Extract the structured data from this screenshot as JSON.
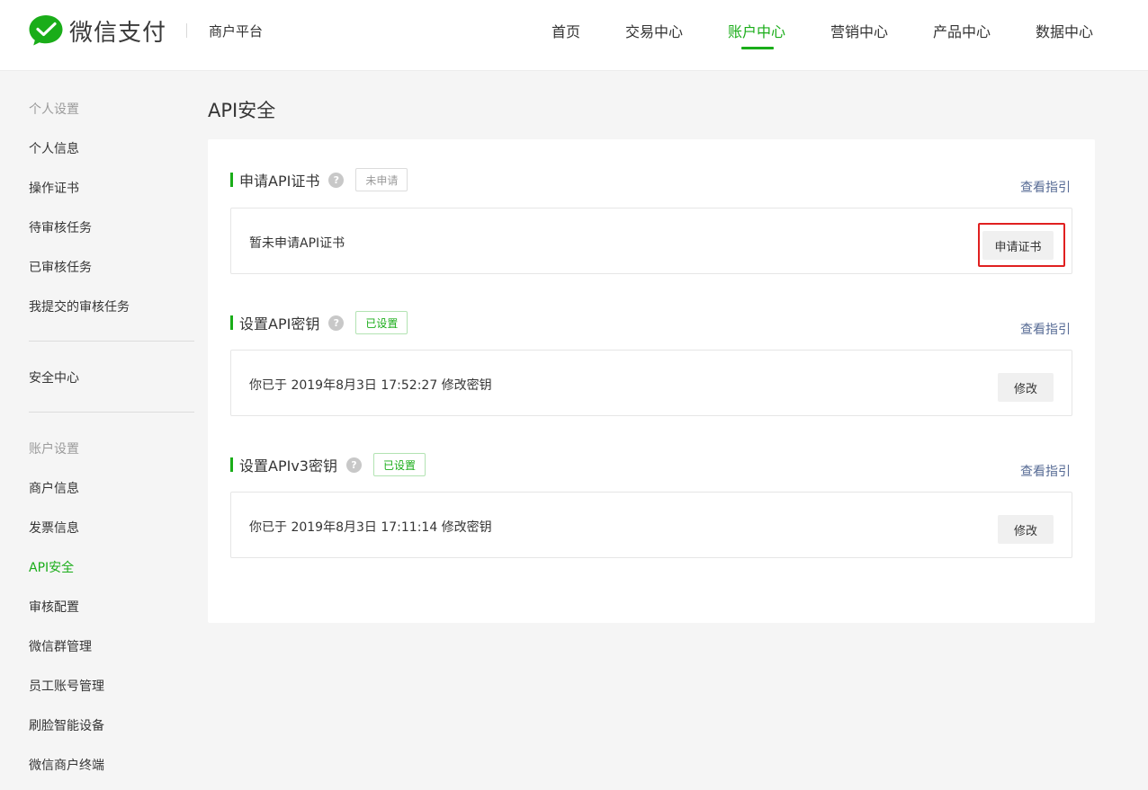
{
  "brand": {
    "logo_text": "微信支付",
    "platform": "商户平台",
    "logo_color": "#1aad19"
  },
  "nav": {
    "items": [
      {
        "label": "首页"
      },
      {
        "label": "交易中心"
      },
      {
        "label": "账户中心",
        "active": true
      },
      {
        "label": "营销中心"
      },
      {
        "label": "产品中心"
      },
      {
        "label": "数据中心"
      }
    ]
  },
  "sidebar": {
    "group1_title": "个人设置",
    "group1_items": [
      "个人信息",
      "操作证书",
      "待审核任务",
      "已审核任务",
      "我提交的审核任务"
    ],
    "security_center": "安全中心",
    "group2_title": "账户设置",
    "group2_items": [
      "商户信息",
      "发票信息",
      "API安全",
      "审核配置",
      "微信群管理",
      "员工账号管理",
      "刷脸智能设备",
      "微信商户终端"
    ],
    "active_item": "API安全"
  },
  "main": {
    "title": "API安全",
    "sections": [
      {
        "title": "申请API证书",
        "help": "?",
        "status": "未申请",
        "guide": "查看指引",
        "message": "暂未申请API证书",
        "button": "申请证书"
      },
      {
        "title": "设置API密钥",
        "help": "?",
        "status": "已设置",
        "guide": "查看指引",
        "message": "你已于 2019年8月3日 17:52:27 修改密钥",
        "button": "修改"
      },
      {
        "title": "设置APIv3密钥",
        "help": "?",
        "status": "已设置",
        "guide": "查看指引",
        "message": "你已于 2019年8月3日 17:11:14 修改密钥",
        "button": "修改"
      }
    ]
  },
  "colors": {
    "accent": "#1aad19",
    "link": "#576b95",
    "highlight": "#e02020"
  }
}
